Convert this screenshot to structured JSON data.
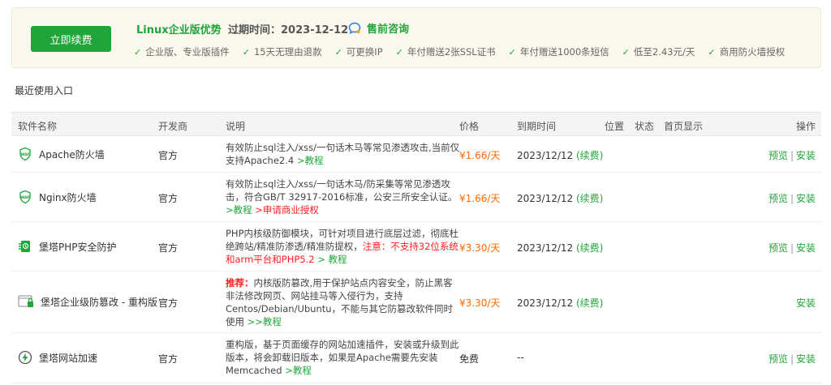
{
  "banner": {
    "renew_label": "立即续费",
    "edition_title": "Linux企业版优势",
    "expire_label": "过期时间：",
    "expire_date": "2023-12-12",
    "consult_label": "售前咨询",
    "features": [
      "企业版、专业版插件",
      "15天无理由退款",
      "可更换IP",
      "年付赠送2张SSL证书",
      "年付赠送1000条短信",
      "低至2.43元/天",
      "商用防火墙授权"
    ]
  },
  "section_title": "最近使用入口",
  "table": {
    "headers": {
      "name": "软件名称",
      "developer": "开发商",
      "description": "说明",
      "price": "价格",
      "expiry": "到期时间",
      "position": "位置",
      "status": "状态",
      "homepage": "首页显示",
      "actions": "操作"
    },
    "rows": [
      {
        "name": "Apache防火墙",
        "developer": "官方",
        "desc_text": "有效防止sql注入/xss/一句话木马等常见渗透攻击,当前仅支持Apache2.4 ",
        "desc_link": ">教程",
        "desc_warn": "",
        "desc_warn_link": "",
        "price": "¥1.66/天",
        "expiry_date": "2023/12/12",
        "expiry_renew": "(续费)",
        "preview": "预览",
        "install": "安装"
      },
      {
        "name": "Nginx防火墙",
        "developer": "官方",
        "desc_text": "有效防止sql注入/xss/一句话木马/防采集等常见渗透攻击，符合GB/T 32917-2016标准，公安三所安全认证。",
        "desc_link": ">教程",
        "desc_warn_link": ">申请商业授权",
        "price": "¥1.66/天",
        "expiry_date": "2023/12/12",
        "expiry_renew": "(续费)",
        "preview": "预览",
        "install": "安装"
      },
      {
        "name": "堡塔PHP安全防护",
        "developer": "官方",
        "desc_text": "PHP内核级防御模块，可针对项目进行底层过滤，彻底杜绝跨站/精准防渗透/精准防提权，",
        "desc_warn": "注意：不支持32位系统和arm平台和PHP5.2",
        "desc_link": " > 教程",
        "price": "¥3.30/天",
        "expiry_date": "2023/12/12",
        "expiry_renew": "(续费)",
        "preview": "预览",
        "install": "安装"
      },
      {
        "name": "堡塔企业级防篡改 - 重构版",
        "developer": "官方",
        "desc_warn": "推荐：",
        "desc_text": "内核版防篡改,用于保护站点内容安全，防止黑客非法修改网页、网站挂马等入侵行为，支持Centos/Debian/Ubuntu，不能与其它防篡改软件同时使用 ",
        "desc_link": ">>教程",
        "price": "¥3.30/天",
        "expiry_date": "2023/12/12",
        "expiry_renew": "(续费)",
        "install": "安装"
      },
      {
        "name": "堡塔网站加速",
        "developer": "官方",
        "desc_text": "重构版，基于页面缓存的网站加速插件，安装或升级到此版本，将会卸载旧版本，如果是Apache需要先安装Memcached ",
        "desc_link": ">教程",
        "price": "免费",
        "expiry_date": "--",
        "preview": "预览",
        "install": "安装"
      }
    ]
  },
  "icons": {
    "row0": "waf-shield-icon",
    "row1": "waf-shield-icon",
    "row2": "php-security-icon",
    "row3": "tamper-proof-icon",
    "row4": "lightning-accelerate-icon"
  },
  "colors": {
    "accent": "#20a53a",
    "price": "#ff6a00",
    "warning": "#ff2020",
    "banner_bg": "#fbf9ee"
  }
}
